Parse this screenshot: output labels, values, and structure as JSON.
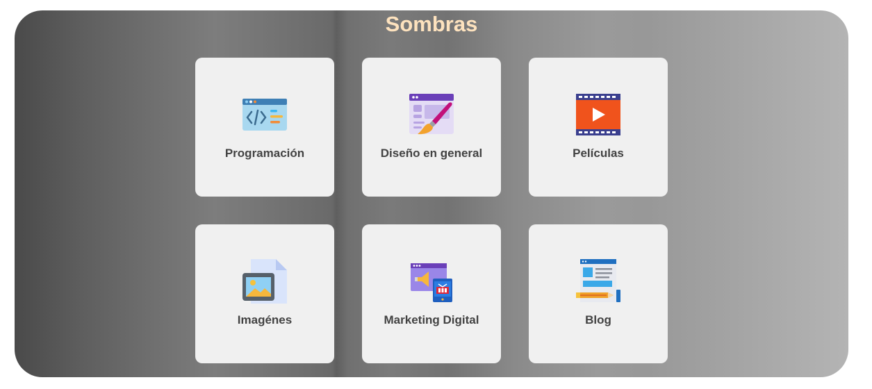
{
  "page": {
    "title": "Sombras"
  },
  "cards": [
    {
      "label": "Programación",
      "icon": "code-window-icon"
    },
    {
      "label": "Diseño en general",
      "icon": "design-brush-icon"
    },
    {
      "label": "Películas",
      "icon": "film-play-icon"
    },
    {
      "label": "Imagénes",
      "icon": "image-file-icon"
    },
    {
      "label": "Marketing Digital",
      "icon": "marketing-megaphone-icon"
    },
    {
      "label": "Blog",
      "icon": "blog-document-icon"
    }
  ],
  "colors": {
    "title": "#fde2be",
    "card_bg": "#f0f0f0",
    "label": "#424242"
  }
}
